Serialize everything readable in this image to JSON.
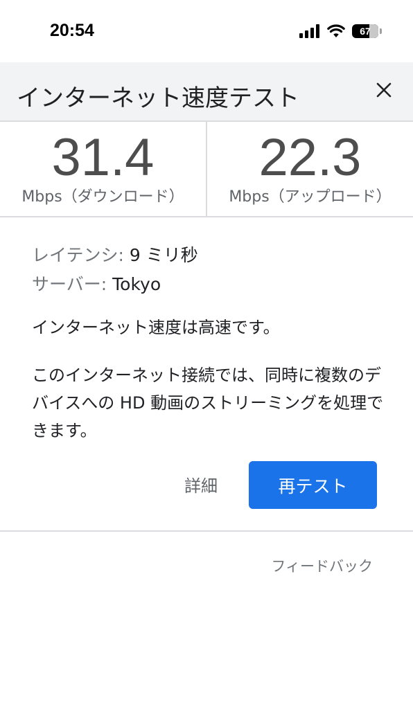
{
  "status_bar": {
    "time": "20:54",
    "battery": "67",
    "battery_level": 0.67,
    "icons": [
      "signal-icon",
      "wifi-icon",
      "battery-icon"
    ]
  },
  "header": {
    "title": "インターネット速度テスト",
    "close_icon": "close-icon"
  },
  "speeds": {
    "download_value": "31.4",
    "download_unit": "Mbps（ダウンロード）",
    "upload_value": "22.3",
    "upload_unit": "Mbps（アップロード）"
  },
  "info": {
    "latency_label": "レイテンシ:",
    "latency_value": "9 ミリ秒",
    "server_label": "サーバー:",
    "server_value": "Tokyo"
  },
  "message": "インターネット速度は高速です。",
  "description": "このインターネット接続では、同時に複数のデバイスへの HD 動画のストリーミングを処理できます。",
  "actions": {
    "details_label": "詳細",
    "retest_label": "再テスト"
  },
  "feedback_label": "フィードバック",
  "colors": {
    "accent": "#1a73e8",
    "header_bg": "#f1f3f4",
    "divider": "#dadce0"
  }
}
